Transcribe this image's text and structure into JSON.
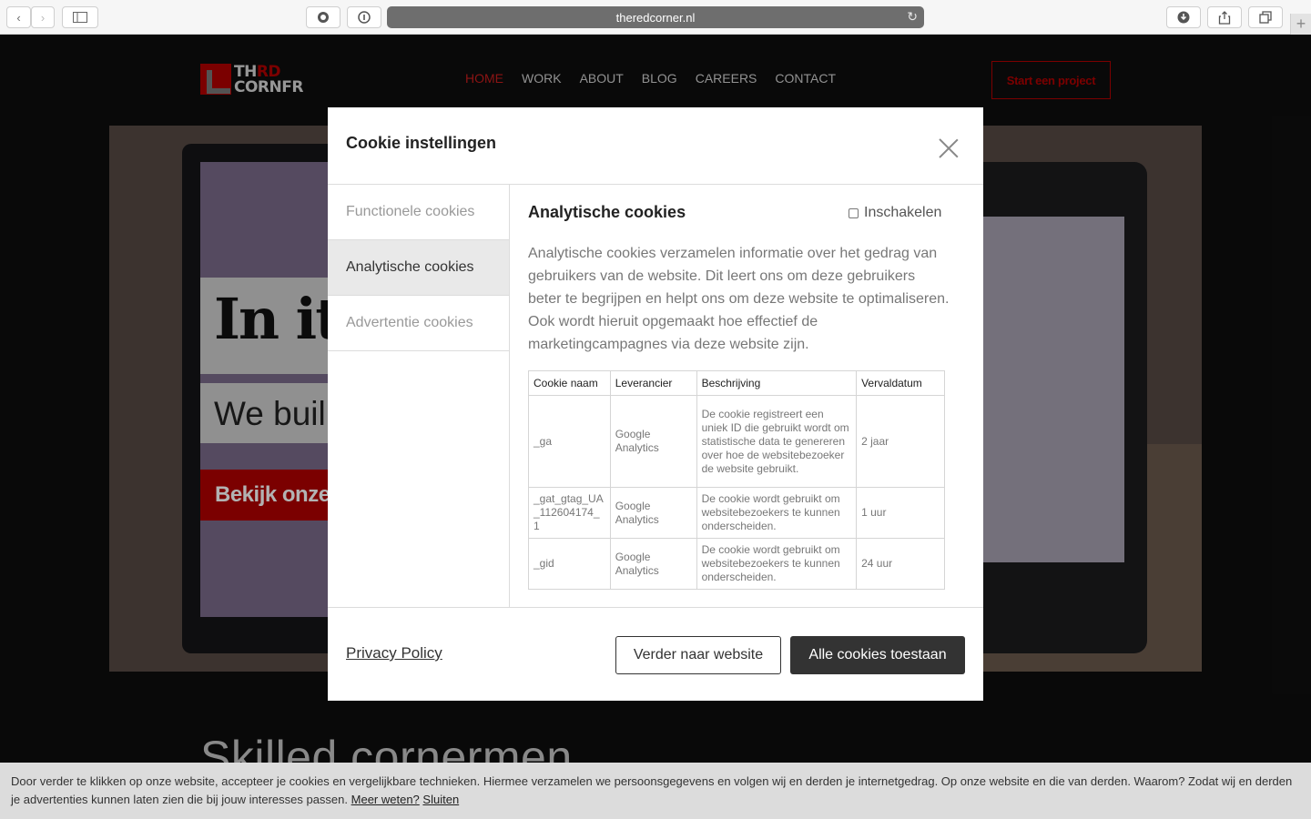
{
  "browser": {
    "url": "theredcorner.nl",
    "icons": {
      "back": "chevron-left-icon",
      "forward": "chevron-right-icon",
      "sidebar": "sidebar-icon",
      "reload": "reload-icon",
      "download": "download-icon",
      "share": "share-icon",
      "tabs": "tabs-icon",
      "new_tab": "plus-icon"
    }
  },
  "site": {
    "logo": {
      "line1_a": "TH",
      "line1_b": "R",
      "line1_c": "D",
      "line2": "CORNFR"
    },
    "nav": [
      "HOME",
      "WORK",
      "ABOUT",
      "BLOG",
      "CAREERS",
      "CONTACT"
    ],
    "cta": "Start een project",
    "hero": {
      "title": "In it",
      "subtitle": "We buil",
      "button": "Bekijk onze c"
    },
    "section_heading": "Skilled cornermen"
  },
  "modal": {
    "title": "Cookie instellingen",
    "tabs": [
      "Functionele cookies",
      "Analytische cookies",
      "Advertentie cookies"
    ],
    "section": {
      "title": "Analytische cookies",
      "toggle_label": "Inschakelen",
      "description": "Analytische cookies verzamelen informatie over het gedrag van gebruikers van de website. Dit leert ons om deze gebruikers beter te begrijpen en helpt ons om deze website te optimaliseren. Ook wordt hieruit opgemaakt hoe effectief de marketingcampagnes via deze website zijn."
    },
    "table": {
      "headers": [
        "Cookie naam",
        "Leverancier",
        "Beschrijving",
        "Vervaldatum"
      ],
      "rows": [
        [
          "_ga",
          "Google Analytics",
          "De cookie registreert een uniek ID die gebruikt wordt om statistische data te genereren over hoe de websitebezoeker de website gebruikt.",
          "2 jaar"
        ],
        [
          "_gat_gtag_UA_112604174_1",
          "Google Analytics",
          "De cookie wordt gebruikt om websitebezoekers te kunnen onderscheiden.",
          "1 uur"
        ],
        [
          "_gid",
          "Google Analytics",
          "De cookie wordt gebruikt om websitebezoekers te kunnen onderscheiden.",
          "24 uur"
        ]
      ]
    },
    "privacy_link": "Privacy Policy",
    "continue_button": "Verder naar website",
    "accept_button": "Alle cookies toestaan"
  },
  "cookie_bar": {
    "text": "Door verder te klikken op onze website, accepteer je cookies en vergelijkbare technieken. Hiermee verzamelen we persoonsgegevens en volgen wij en derden je internetgedrag. Op onze website en die van derden. Waarom? Zodat wij en derden je advertenties kunnen laten zien die bij jouw interesses passen.",
    "more_link": "Meer weten?",
    "close_link": "Sluiten"
  },
  "colors": {
    "brand_red": "#b00000",
    "nav_active": "#c81d1d",
    "button_dark": "#333333"
  }
}
